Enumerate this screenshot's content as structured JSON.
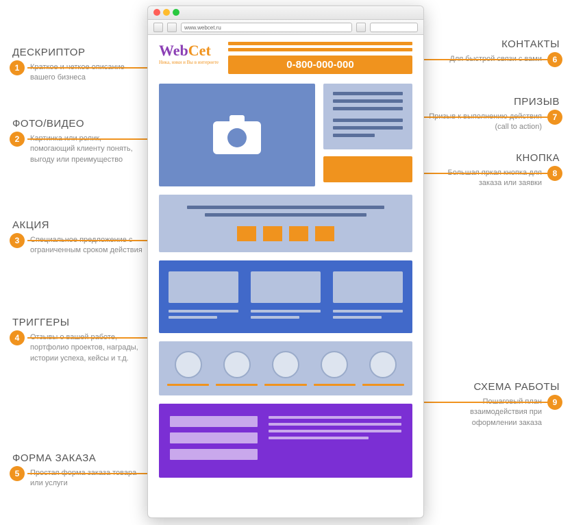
{
  "browser": {
    "url": "www.webcet.ru"
  },
  "logo": {
    "name_part1": "Web",
    "name_part2": "Cet",
    "tagline": "Ника, ники и Вы в интернете"
  },
  "phone": "0-800-000-000",
  "annotations": {
    "left": [
      {
        "num": "1",
        "title": "ДЕСКРИПТОР",
        "desc": "Краткое и четкое описание вашего бизнеса"
      },
      {
        "num": "2",
        "title": "ФОТО/ВИДЕО",
        "desc": "Картинка или ролик, помогающий клиенту понять, выгоду или преимущество"
      },
      {
        "num": "3",
        "title": "АКЦИЯ",
        "desc": "Специальное предложение с ограниченным сроком действия"
      },
      {
        "num": "4",
        "title": "ТРИГГЕРЫ",
        "desc": "Отзывы о вашей работе, портфолио проектов, награды, истории успеха, кейсы и т.д."
      },
      {
        "num": "5",
        "title": "ФОРМА ЗАКАЗА",
        "desc": "Простая форма заказа товара или услуги"
      }
    ],
    "right": [
      {
        "num": "6",
        "title": "КОНТАКТЫ",
        "desc": "Для быстрой связи с вами"
      },
      {
        "num": "7",
        "title": "ПРИЗЫВ",
        "desc": "Призыв к выполнению действия (call to action)"
      },
      {
        "num": "8",
        "title": "КНОПКА",
        "desc": "Большая яркая кнопка для заказа или заявки"
      },
      {
        "num": "9",
        "title": "СХЕМА РАБОТЫ",
        "desc": "Пошаговый план взаимодействия при оформлении заказа"
      }
    ]
  }
}
